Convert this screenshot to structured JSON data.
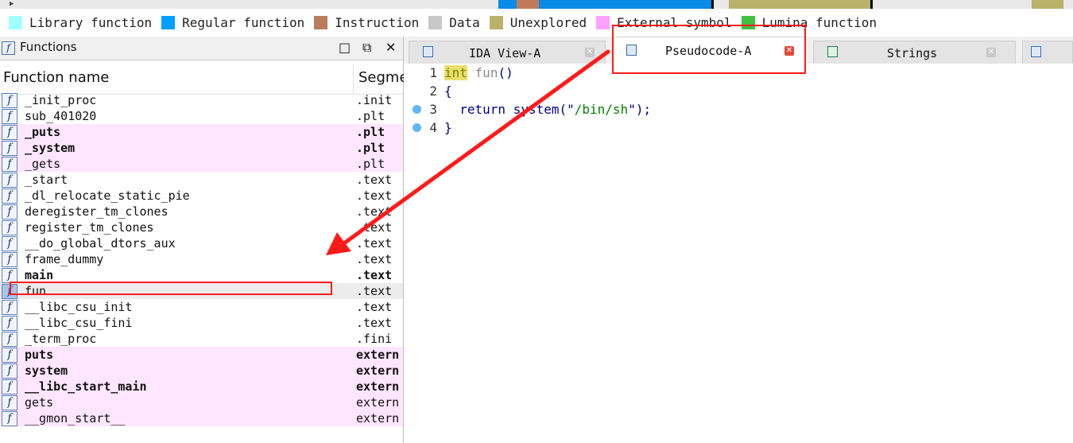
{
  "colors": {
    "navband": [
      "#0a8be8",
      "#b9b26a",
      "#c07a5a",
      "#000000",
      "#e9e9e9"
    ],
    "legend": [
      "#a0ffff",
      "#00a0ff",
      "#b97d5e",
      "#c8c8c8",
      "#b9b26a",
      "#ffa0ff",
      "#40c040"
    ],
    "annotation": "#ff1a1a",
    "external_row": "#ffe6ff"
  },
  "legend": [
    {
      "label": "Library function"
    },
    {
      "label": "Regular function"
    },
    {
      "label": "Instruction"
    },
    {
      "label": "Data"
    },
    {
      "label": "Unexplored"
    },
    {
      "label": "External symbol"
    },
    {
      "label": "Lumina function"
    }
  ],
  "functions_panel": {
    "title": "Functions",
    "icon": "function-icon",
    "controls": {
      "maximize": "□",
      "restore": "⧉",
      "close": "✕"
    },
    "columns": {
      "name": "Function name",
      "segment": "Segme"
    },
    "rows": [
      {
        "name": "_init_proc",
        "segment": ".init",
        "external": false,
        "bold": false
      },
      {
        "name": "sub_401020",
        "segment": ".plt",
        "external": false,
        "bold": false
      },
      {
        "name": "_puts",
        "segment": ".plt",
        "external": true,
        "bold": true
      },
      {
        "name": "_system",
        "segment": ".plt",
        "external": true,
        "bold": true
      },
      {
        "name": "_gets",
        "segment": ".plt",
        "external": true,
        "bold": false
      },
      {
        "name": "_start",
        "segment": ".text",
        "external": false,
        "bold": false
      },
      {
        "name": "_dl_relocate_static_pie",
        "segment": ".text",
        "external": false,
        "bold": false
      },
      {
        "name": "deregister_tm_clones",
        "segment": ".text",
        "external": false,
        "bold": false
      },
      {
        "name": "register_tm_clones",
        "segment": ".text",
        "external": false,
        "bold": false
      },
      {
        "name": "__do_global_dtors_aux",
        "segment": ".text",
        "external": false,
        "bold": false
      },
      {
        "name": "frame_dummy",
        "segment": ".text",
        "external": false,
        "bold": false
      },
      {
        "name": "main",
        "segment": ".text",
        "external": false,
        "bold": true
      },
      {
        "name": "fun",
        "segment": ".text",
        "external": false,
        "bold": false,
        "selected": true
      },
      {
        "name": "__libc_csu_init",
        "segment": ".text",
        "external": false,
        "bold": false
      },
      {
        "name": "__libc_csu_fini",
        "segment": ".text",
        "external": false,
        "bold": false
      },
      {
        "name": "_term_proc",
        "segment": ".fini",
        "external": false,
        "bold": false
      },
      {
        "name": "puts",
        "segment": "extern",
        "external": true,
        "bold": true
      },
      {
        "name": "system",
        "segment": "extern",
        "external": true,
        "bold": true
      },
      {
        "name": "__libc_start_main",
        "segment": "extern",
        "external": true,
        "bold": true
      },
      {
        "name": "gets",
        "segment": "extern",
        "external": true,
        "bold": false
      },
      {
        "name": "__gmon_start__",
        "segment": "extern",
        "external": true,
        "bold": false
      }
    ]
  },
  "tabs": [
    {
      "label": "IDA View-A",
      "icon": "disassembly-icon",
      "active": false
    },
    {
      "label": "Pseudocode-A",
      "icon": "pseudocode-icon",
      "active": true
    },
    {
      "label": "Strings",
      "icon": "strings-icon",
      "active": false
    },
    {
      "label": "",
      "icon": "hex-view-icon",
      "active": false
    }
  ],
  "code": {
    "lines": [
      {
        "num": "1",
        "parts": [
          {
            "t": "int",
            "c": "kw-hl"
          },
          {
            "t": " "
          },
          {
            "t": "fun",
            "c": "fn"
          },
          {
            "t": "()"
          }
        ],
        "breakpoint": false
      },
      {
        "num": "2",
        "parts": [
          {
            "t": "{"
          }
        ],
        "breakpoint": false
      },
      {
        "num": "3",
        "parts": [
          {
            "t": "  return system(\""
          },
          {
            "t": "/bin/sh",
            "c": "str"
          },
          {
            "t": "\");"
          }
        ],
        "breakpoint": true
      },
      {
        "num": "4",
        "parts": [
          {
            "t": "}"
          }
        ],
        "breakpoint": true
      }
    ]
  }
}
